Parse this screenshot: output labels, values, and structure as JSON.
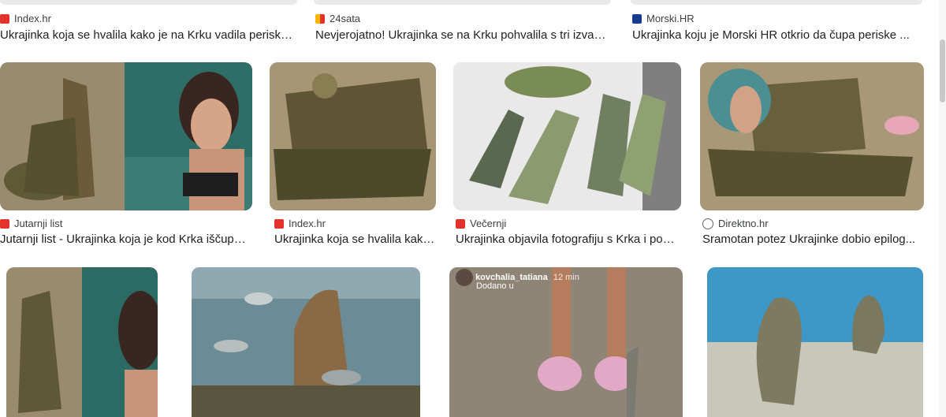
{
  "colors": {
    "red_favicon": "#e5322d",
    "blue_favicon": "#1a3d8f",
    "orange_favicon": "#f25a29"
  },
  "row1": [
    {
      "source": "Index.hr",
      "title": "Ukrajinka koja se hvalila kako je na Krku vadila periske je...",
      "favicon": "red-square-icon"
    },
    {
      "source": "24sata",
      "title": "Nevjerojatno! Ukrajinka se na Krku pohvalila s tri izvađene...",
      "favicon": "24sata-logo-icon"
    },
    {
      "source": "Morski.HR",
      "title": "Ukrajinka koju je Morski HR otkrio da čupa periske ...",
      "favicon": "morski-people-icon"
    }
  ],
  "row2": [
    {
      "source": "Jutarnji list",
      "title": "Jutarnji list - Ukrajinka koja je kod Krka iščupala...",
      "favicon": "jutarnji-icon"
    },
    {
      "source": "Index.hr",
      "title": "Ukrajinka koja se hvalila kako je na Krku...",
      "favicon": "red-square-icon"
    },
    {
      "source": "Večernji",
      "title": "Ukrajinka objavila fotografiju s Krka i pokazala...",
      "favicon": "vl-logo-icon"
    },
    {
      "source": "Direktno.hr",
      "title": "Sramotan potez Ukrajinke dobio epilog...",
      "favicon": "direktno-icon"
    }
  ],
  "row3_overlay": {
    "username": "kovchalia_tatiana",
    "time": "12 min",
    "added": "Dodano u"
  }
}
